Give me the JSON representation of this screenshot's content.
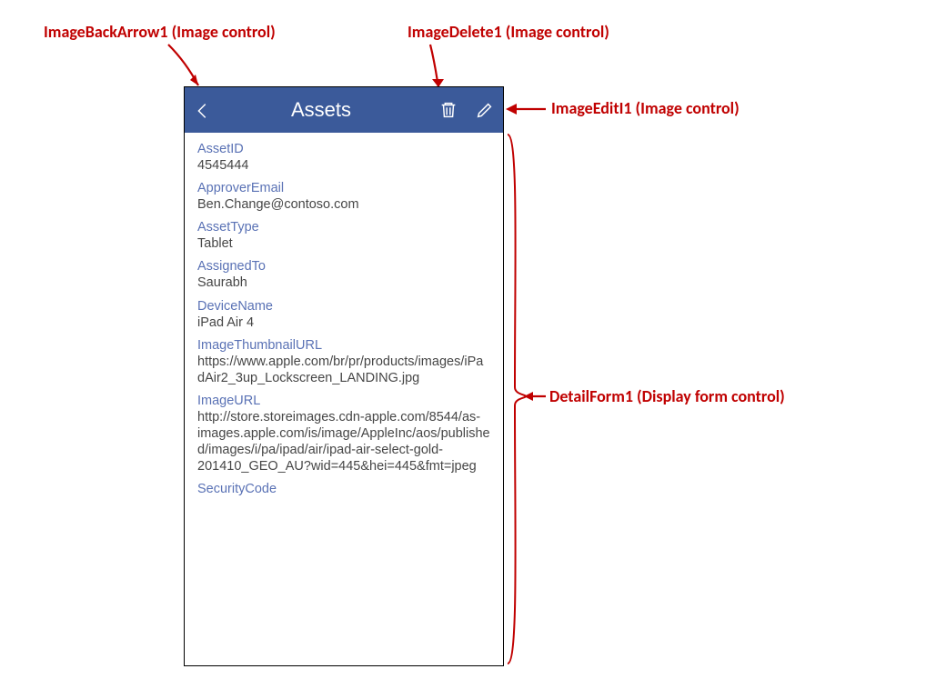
{
  "annotations": {
    "back_arrow": "ImageBackArrow1 (Image control)",
    "delete": "ImageDelete1 (Image control)",
    "edit": "ImageEditI1 (Image control)",
    "detail_form": "DetailForm1 (Display form control)"
  },
  "header": {
    "title": "Assets"
  },
  "form": {
    "fields": [
      {
        "label": "AssetID",
        "value": "4545444"
      },
      {
        "label": "ApproverEmail",
        "value": "Ben.Change@contoso.com"
      },
      {
        "label": "AssetType",
        "value": "Tablet"
      },
      {
        "label": "AssignedTo",
        "value": "Saurabh"
      },
      {
        "label": "DeviceName",
        "value": "iPad Air 4"
      },
      {
        "label": "ImageThumbnailURL",
        "value": "https://www.apple.com/br/pr/products/images/iPadAir2_3up_Lockscreen_LANDING.jpg"
      },
      {
        "label": "ImageURL",
        "value": "http://store.storeimages.cdn-apple.com/8544/as-images.apple.com/is/image/AppleInc/aos/published/images/i/pa/ipad/air/ipad-air-select-gold-201410_GEO_AU?wid=445&hei=445&fmt=jpeg"
      },
      {
        "label": "SecurityCode",
        "value": ""
      }
    ]
  }
}
